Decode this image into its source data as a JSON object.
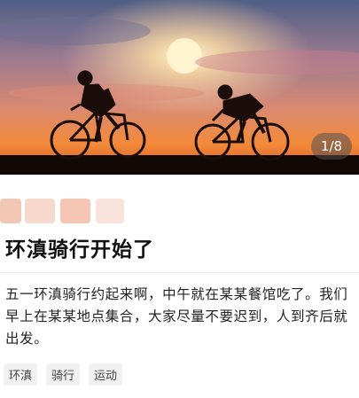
{
  "post": {
    "image_counter": "1/8",
    "title": "环滇骑行开始了",
    "body": "五一环滇骑行约起来啊，中午就在某某餐馆吃了。我们早上在某某地点集合，大家尽量不要迟到，人到齐后就出发。",
    "tags": [
      "环滇",
      "骑行",
      "运动"
    ]
  },
  "colors": {
    "sky_top": "#4f5f86",
    "sky_mid": "#d98a72",
    "sun": "#fff4cf",
    "horizon": "#f38a3a",
    "silhouette": "#1a0d0a"
  }
}
